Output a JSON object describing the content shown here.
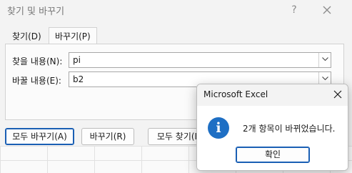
{
  "dialog": {
    "title": "찾기 및 바꾸기",
    "help_glyph": "?",
    "tabs": [
      {
        "label": "찾기(D)",
        "active": false
      },
      {
        "label": "바꾸기(P)",
        "active": true
      }
    ],
    "find_label": "찾을 내용(N):",
    "find_value": "pi",
    "replace_label": "바꿀 내용(E):",
    "replace_value": "b2",
    "buttons": {
      "replace_all": "모두 바꾸기(A)",
      "replace": "바꾸기(R)",
      "find_all": "모두 찾기(I"
    }
  },
  "message_box": {
    "title": "Microsoft Excel",
    "icon": "info-icon",
    "icon_glyph": "i",
    "message": "2개 항목이 바뀌었습니다.",
    "ok_label": "확인"
  },
  "colors": {
    "accent": "#1a5fb4",
    "info_icon": "#1e6fc4"
  }
}
